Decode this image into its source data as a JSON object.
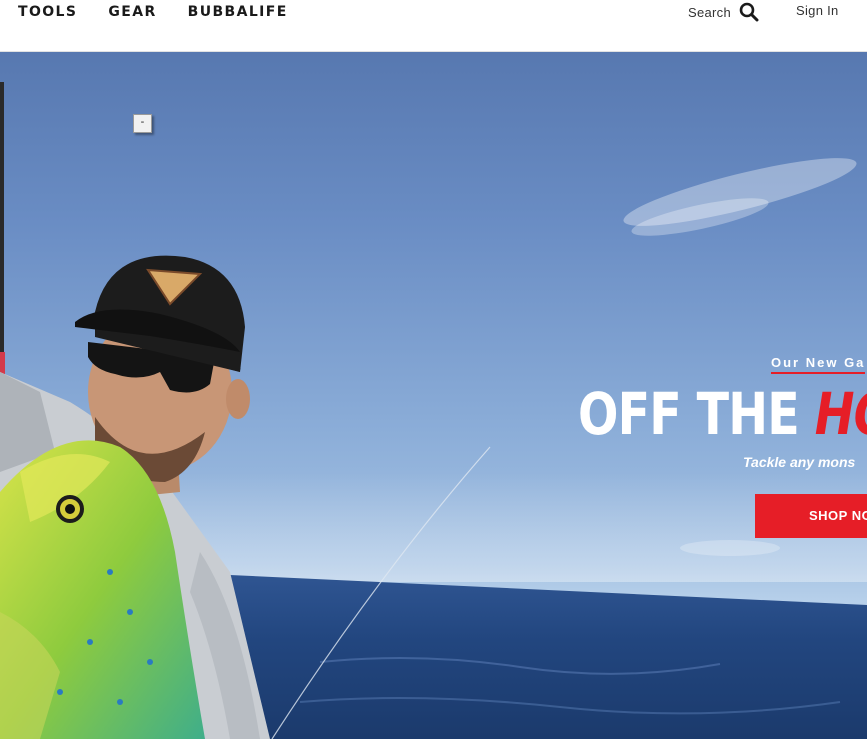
{
  "header": {
    "nav": [
      "TOOLS",
      "GEAR",
      "BUBBALIFE"
    ],
    "search_label": "Search",
    "signin_label": "Sign In"
  },
  "hero": {
    "collapse_label": "-",
    "eyebrow": "Our New Ga",
    "headline_part1": "OFF THE ",
    "headline_part2": "HO",
    "subhead": "Tackle any mons",
    "cta_label": "SHOP NOW"
  },
  "colors": {
    "accent": "#e61e27",
    "sky": "#6a8dc4",
    "ocean": "#1f3f78"
  },
  "icons": {
    "search": "search-icon",
    "collapse": "minus-icon"
  }
}
